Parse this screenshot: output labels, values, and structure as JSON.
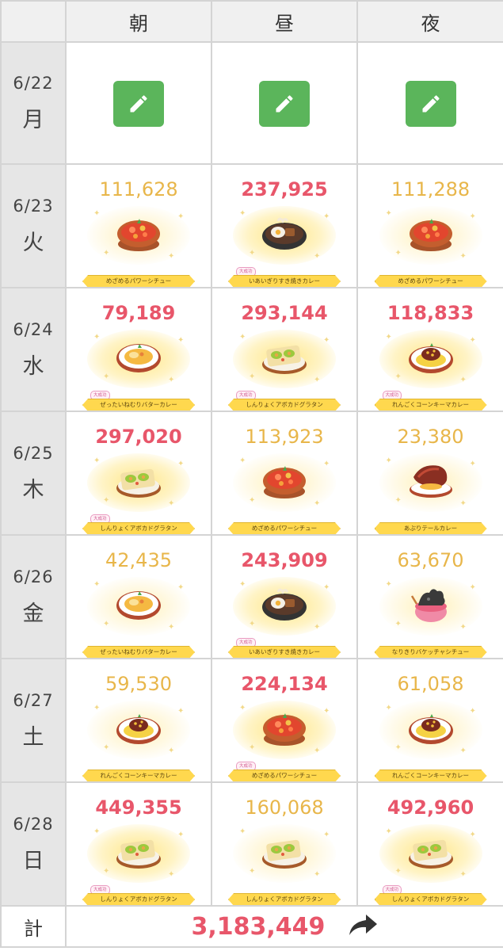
{
  "header": {
    "columns": [
      "朝",
      "昼",
      "夜"
    ]
  },
  "days": [
    {
      "date": "6/22",
      "weekday": "月",
      "editable": true,
      "meals": []
    },
    {
      "date": "6/23",
      "weekday": "火",
      "meals": [
        {
          "score": "111,628",
          "big": false,
          "dish": "めざめるパワーシチュー",
          "icon": "stew-icon",
          "badge": ""
        },
        {
          "score": "237,925",
          "big": true,
          "dish": "いあいぎりすき焼きカレー",
          "icon": "sukiyaki-curry-icon",
          "badge": "大成功"
        },
        {
          "score": "111,288",
          "big": false,
          "dish": "めざめるパワーシチュー",
          "icon": "stew-icon",
          "badge": ""
        }
      ]
    },
    {
      "date": "6/24",
      "weekday": "水",
      "meals": [
        {
          "score": "79,189",
          "big": true,
          "dish": "ぜったいねむりバターカレー",
          "icon": "butter-curry-icon",
          "badge": "大成功"
        },
        {
          "score": "293,144",
          "big": true,
          "dish": "しんりょくアボカドグラタン",
          "icon": "avocado-gratin-icon",
          "badge": "大成功"
        },
        {
          "score": "118,833",
          "big": true,
          "dish": "れんごくコーンキーマカレー",
          "icon": "keema-curry-icon",
          "badge": "大成功"
        }
      ]
    },
    {
      "date": "6/25",
      "weekday": "木",
      "meals": [
        {
          "score": "297,020",
          "big": true,
          "dish": "しんりょくアボカドグラタン",
          "icon": "avocado-gratin-icon",
          "badge": "大成功"
        },
        {
          "score": "113,923",
          "big": false,
          "dish": "めざめるパワーシチュー",
          "icon": "stew-icon",
          "badge": ""
        },
        {
          "score": "23,380",
          "big": false,
          "dish": "あぶりテールカレー",
          "icon": "tail-curry-icon",
          "badge": ""
        }
      ]
    },
    {
      "date": "6/26",
      "weekday": "金",
      "meals": [
        {
          "score": "42,435",
          "big": false,
          "dish": "ぜったいねむりバターカレー",
          "icon": "butter-curry-icon",
          "badge": ""
        },
        {
          "score": "243,909",
          "big": true,
          "dish": "いあいぎりすき焼きカレー",
          "icon": "sukiyaki-curry-icon",
          "badge": "大成功"
        },
        {
          "score": "63,670",
          "big": false,
          "dish": "なりきりバケッチャシチュー",
          "icon": "pumpkin-stew-icon",
          "badge": ""
        }
      ]
    },
    {
      "date": "6/27",
      "weekday": "土",
      "meals": [
        {
          "score": "59,530",
          "big": false,
          "dish": "れんごくコーンキーマカレー",
          "icon": "keema-curry-icon",
          "badge": ""
        },
        {
          "score": "224,134",
          "big": true,
          "dish": "めざめるパワーシチュー",
          "icon": "stew-icon",
          "badge": "大成功"
        },
        {
          "score": "61,058",
          "big": false,
          "dish": "れんごくコーンキーマカレー",
          "icon": "keema-curry-icon",
          "badge": ""
        }
      ]
    },
    {
      "date": "6/28",
      "weekday": "日",
      "meals": [
        {
          "score": "449,355",
          "big": true,
          "dish": "しんりょくアボカドグラタン",
          "icon": "avocado-gratin-icon",
          "badge": "大成功"
        },
        {
          "score": "160,068",
          "big": false,
          "dish": "しんりょくアボカドグラタン",
          "icon": "avocado-gratin-icon",
          "badge": ""
        },
        {
          "score": "492,960",
          "big": true,
          "dish": "しんりょくアボカドグラタン",
          "icon": "avocado-gratin-icon",
          "badge": "大成功"
        }
      ]
    }
  ],
  "total": {
    "label": "計",
    "value": "3,183,449",
    "share_icon": "share-arrow-icon"
  },
  "colors": {
    "score_normal": "#e8b64a",
    "score_big": "#e8566a",
    "edit_button": "#5bb55b"
  }
}
